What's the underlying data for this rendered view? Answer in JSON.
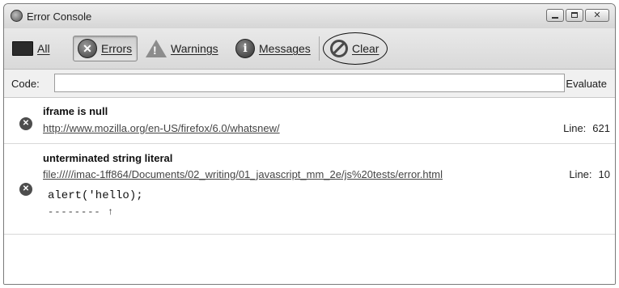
{
  "window": {
    "title": "Error Console"
  },
  "toolbar": {
    "all": "All",
    "errors": "Errors",
    "warnings": "Warnings",
    "messages": "Messages",
    "clear": "Clear"
  },
  "codebar": {
    "label": "Code:",
    "value": "",
    "evaluate": "Evaluate"
  },
  "entries": [
    {
      "message": "iframe is null",
      "source": "http://www.mozilla.org/en-US/firefox/6.0/whatsnew/",
      "line_label": "Line:",
      "line": "621"
    },
    {
      "message": "unterminated string literal",
      "source": "file://///imac-1ff864/Documents/02_writing/01_javascript_mm_2e/js%20tests/error.html",
      "line_label": "Line:",
      "line": "10",
      "code": "alert('hello);",
      "pointer": "-------- ↑"
    }
  ],
  "icons": {
    "app": "firefox-icon",
    "all": "all-messages-icon",
    "errors": "error-icon",
    "warnings": "warning-icon",
    "messages": "info-icon",
    "clear": "clear-icon"
  }
}
